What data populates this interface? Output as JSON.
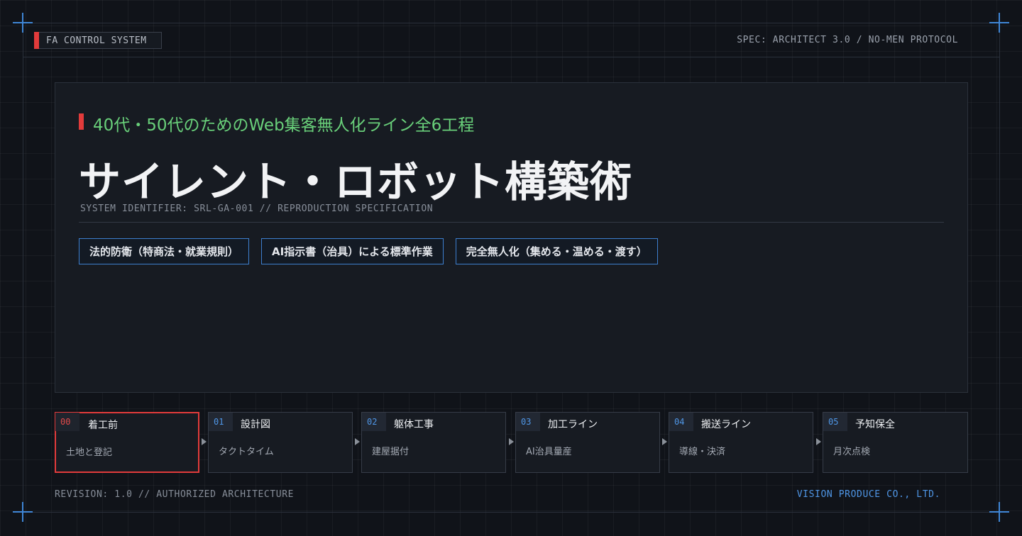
{
  "header": {
    "system_label": "FA CONTROL SYSTEM",
    "spec": "SPEC: ARCHITECT 3.0 / NO-MEN PROTOCOL"
  },
  "hero": {
    "subtitle": "40代・50代のためのWeb集客無人化ライン全6工程",
    "title": "サイレント・ロボット構築術",
    "identifier": "SYSTEM IDENTIFIER: SRL-GA-001 // REPRODUCTION SPECIFICATION",
    "tags": [
      "法的防衛（特商法・就業規則）",
      "AI指示書（治具）による標準作業",
      "完全無人化（集める・温める・渡す）"
    ]
  },
  "steps": [
    {
      "num": "00",
      "name": "着工前",
      "desc": "土地と登記",
      "active": true
    },
    {
      "num": "01",
      "name": "設計図",
      "desc": "タクトタイム",
      "active": false
    },
    {
      "num": "02",
      "name": "躯体工事",
      "desc": "建屋据付",
      "active": false
    },
    {
      "num": "03",
      "name": "加工ライン",
      "desc": "AI治具量産",
      "active": false
    },
    {
      "num": "04",
      "name": "搬送ライン",
      "desc": "導線・決済",
      "active": false
    },
    {
      "num": "05",
      "name": "予知保全",
      "desc": "月次点検",
      "active": false
    }
  ],
  "footer": {
    "revision": "REVISION: 1.0 // AUTHORIZED ARCHITECTURE",
    "company": "VISION PRODUCE CO., LTD."
  },
  "colors": {
    "background": "#101319",
    "accent_red": "#e23b3b",
    "accent_blue": "#4f96e6",
    "subtitle_green": "#69d07a"
  }
}
